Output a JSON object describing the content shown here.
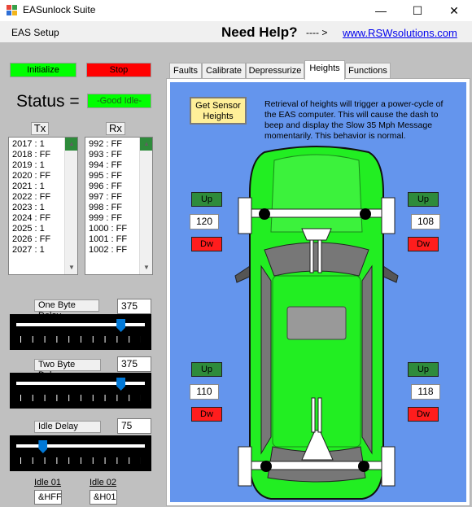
{
  "window": {
    "title": "EASunlock Suite",
    "minimize_glyph": "—",
    "maximize_glyph": "☐",
    "close_glyph": "✕"
  },
  "menu": {
    "eas_setup": "EAS Setup",
    "need_help": "Need Help?",
    "arrow": "---- >",
    "link": "www.RSWsolutions.com"
  },
  "controls": {
    "initialize_label": "Initialize",
    "stop_label": "Stop",
    "status_label": "Status =",
    "status_value": "-Good Idle-",
    "tx_label": "Tx",
    "rx_label": "Rx",
    "tx_items": [
      "2017 : 1",
      "2018 : FF",
      "2019 : 1",
      "2020 : FF",
      "2021 : 1",
      "2022 : FF",
      "2023 : 1",
      "2024 : FF",
      "2025 : 1",
      "2026 : FF",
      "2027 : 1"
    ],
    "rx_items": [
      "992 : FF",
      "993 : FF",
      "994 : FF",
      "995 : FF",
      "996 : FF",
      "997 : FF",
      "998 : FF",
      "999 : FF",
      "1000 : FF",
      "1001 : FF",
      "1002 : FF"
    ]
  },
  "sliders": [
    {
      "label": "One Byte Delay",
      "value": "375",
      "level": 0.81
    },
    {
      "label": "Two Byte Delay",
      "value": "375",
      "level": 0.81
    },
    {
      "label": "Idle Delay",
      "value": "75",
      "level": 0.18
    }
  ],
  "idle": {
    "idle01_label": "Idle 01",
    "idle01_value": "&HFF",
    "idle02_label": "Idle 02",
    "idle02_value": "&H01"
  },
  "tabs": [
    {
      "label": "Faults",
      "active": false
    },
    {
      "label": "Calibrate",
      "active": false
    },
    {
      "label": "Depressurize",
      "active": false
    },
    {
      "label": "Heights",
      "active": true
    },
    {
      "label": "Functions",
      "active": false
    }
  ],
  "heights": {
    "get_sensor_label": "Get Sensor Heights",
    "info_text": "Retrieval of heights will trigger a power-cycle of the EAS computer. This will cause the dash to beep and display the Slow 35 Mph Message momentarily. This behavior is normal.",
    "up_label": "Up",
    "dw_label": "Dw",
    "front_left": "120",
    "front_right": "108",
    "rear_left": "110",
    "rear_right": "118"
  },
  "colors": {
    "initialize": "#00ff00",
    "stop": "#ff0000",
    "status_bg": "#00ff00",
    "panel_blue": "#6495ed",
    "car_green": "#22ee22",
    "up_green": "#2e8b3b",
    "dw_red": "#ff1d1d"
  }
}
